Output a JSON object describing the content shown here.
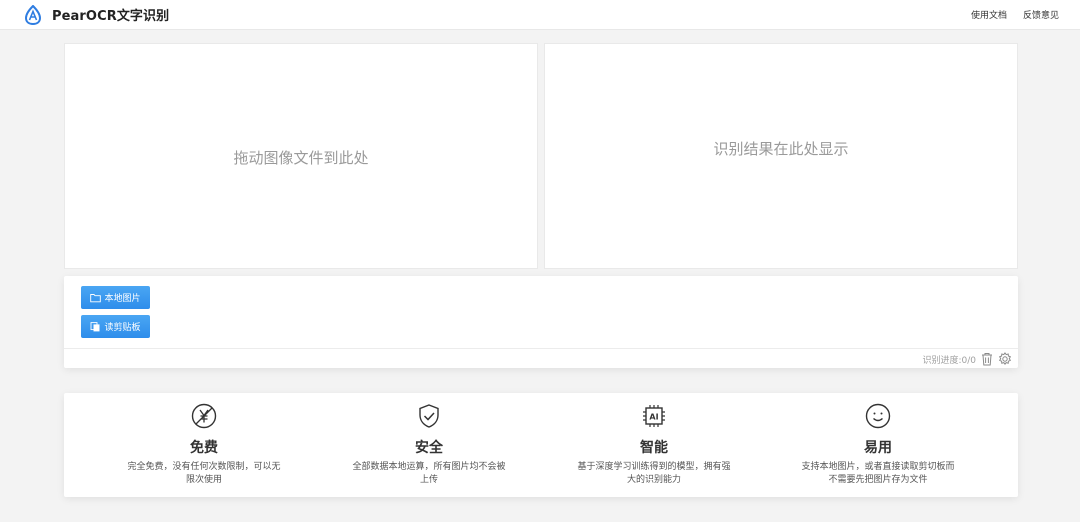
{
  "header": {
    "app_title": "PearOCR文字识别",
    "nav": {
      "docs": "使用文档",
      "feedback": "反馈意见"
    },
    "logo_icon": "pear-logo-icon"
  },
  "panels": {
    "drop_zone_text": "拖动图像文件到此处",
    "result_text": "识别结果在此处显示"
  },
  "controls": {
    "local_image_button": "本地图片",
    "paste_button": "读剪贴板",
    "progress_label": "识别进度:0/0",
    "icons": [
      "folder-icon",
      "clipboard-icon",
      "trash-icon",
      "gear-icon"
    ]
  },
  "features": [
    {
      "icon": "no-yen-icon",
      "title": "免费",
      "desc": "完全免费，没有任何次数限制，可以无限次使用"
    },
    {
      "icon": "shield-check-icon",
      "title": "安全",
      "desc": "全部数据本地运算，所有图片均不会被上传"
    },
    {
      "icon": "ai-chip-icon",
      "title": "智能",
      "desc": "基于深度学习训练得到的模型，拥有强大的识别能力"
    },
    {
      "icon": "smile-icon",
      "title": "易用",
      "desc": "支持本地图片，或者直接读取剪切板而不需要先把图片存为文件"
    }
  ],
  "colors": {
    "accent": "#2e8deb",
    "logo": "#2f7de1",
    "background": "#f3f3f3"
  }
}
